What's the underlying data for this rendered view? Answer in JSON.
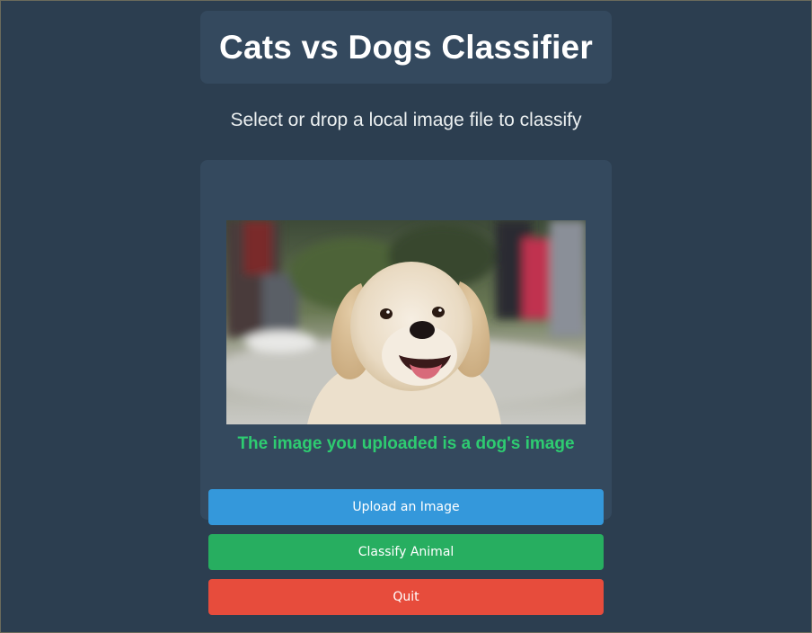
{
  "header": {
    "title": "Cats vs Dogs Classifier"
  },
  "instructions": "Select or drop a local image file to classify",
  "preview": {
    "subject": "golden retriever dog photo"
  },
  "result": {
    "text": "The image you uploaded is a dog's image",
    "color": "#2ecc71"
  },
  "buttons": {
    "upload": "Upload an Image",
    "classify": "Classify Animal",
    "quit": "Quit"
  },
  "colors": {
    "background": "#2c3e50",
    "card": "#34495e",
    "upload": "#3498db",
    "classify": "#27ae60",
    "quit": "#e74c3c"
  }
}
